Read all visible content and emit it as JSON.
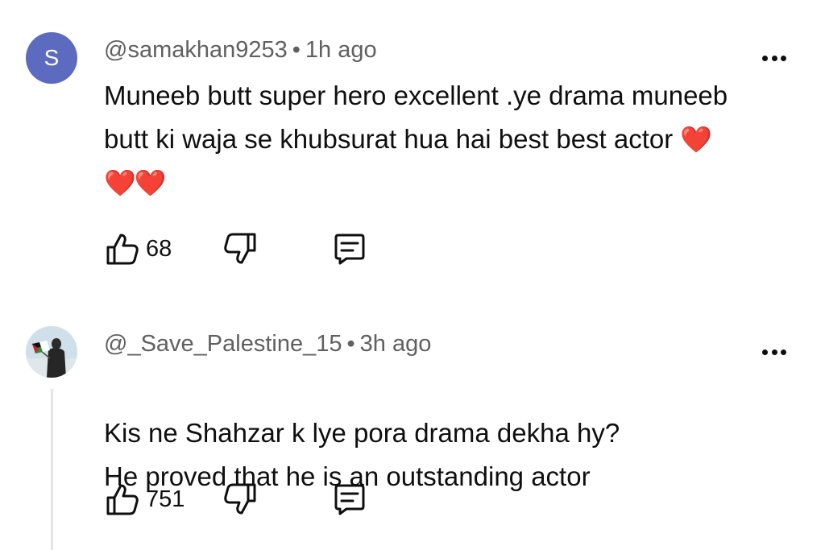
{
  "comments": [
    {
      "avatar_letter": "S",
      "avatar_color": "#5c6bc0",
      "author": "@samakhan9253",
      "separator": "•",
      "time": "1h ago",
      "text": "Muneeb butt super hero excellent .ye drama muneeb butt ki waja se khubsurat hua hai best best actor",
      "emoji": "❤️❤️❤️",
      "likes": "68",
      "icons": {
        "like": "thumbs-up-icon",
        "dislike": "thumbs-down-icon",
        "reply": "reply-icon",
        "more": "more-vert-icon"
      }
    },
    {
      "avatar_letter": "",
      "avatar_color": "#cfe0ea",
      "author": "@_Save_Palestine_15",
      "separator": "•",
      "time": "3h ago",
      "text": "Kis ne Shahzar k lye pora drama dekha hy?\nHe proved that he is an outstanding actor",
      "emoji": "",
      "likes": "751",
      "icons": {
        "like": "thumbs-up-icon",
        "dislike": "thumbs-down-icon",
        "reply": "reply-icon",
        "more": "more-vert-icon"
      }
    }
  ]
}
